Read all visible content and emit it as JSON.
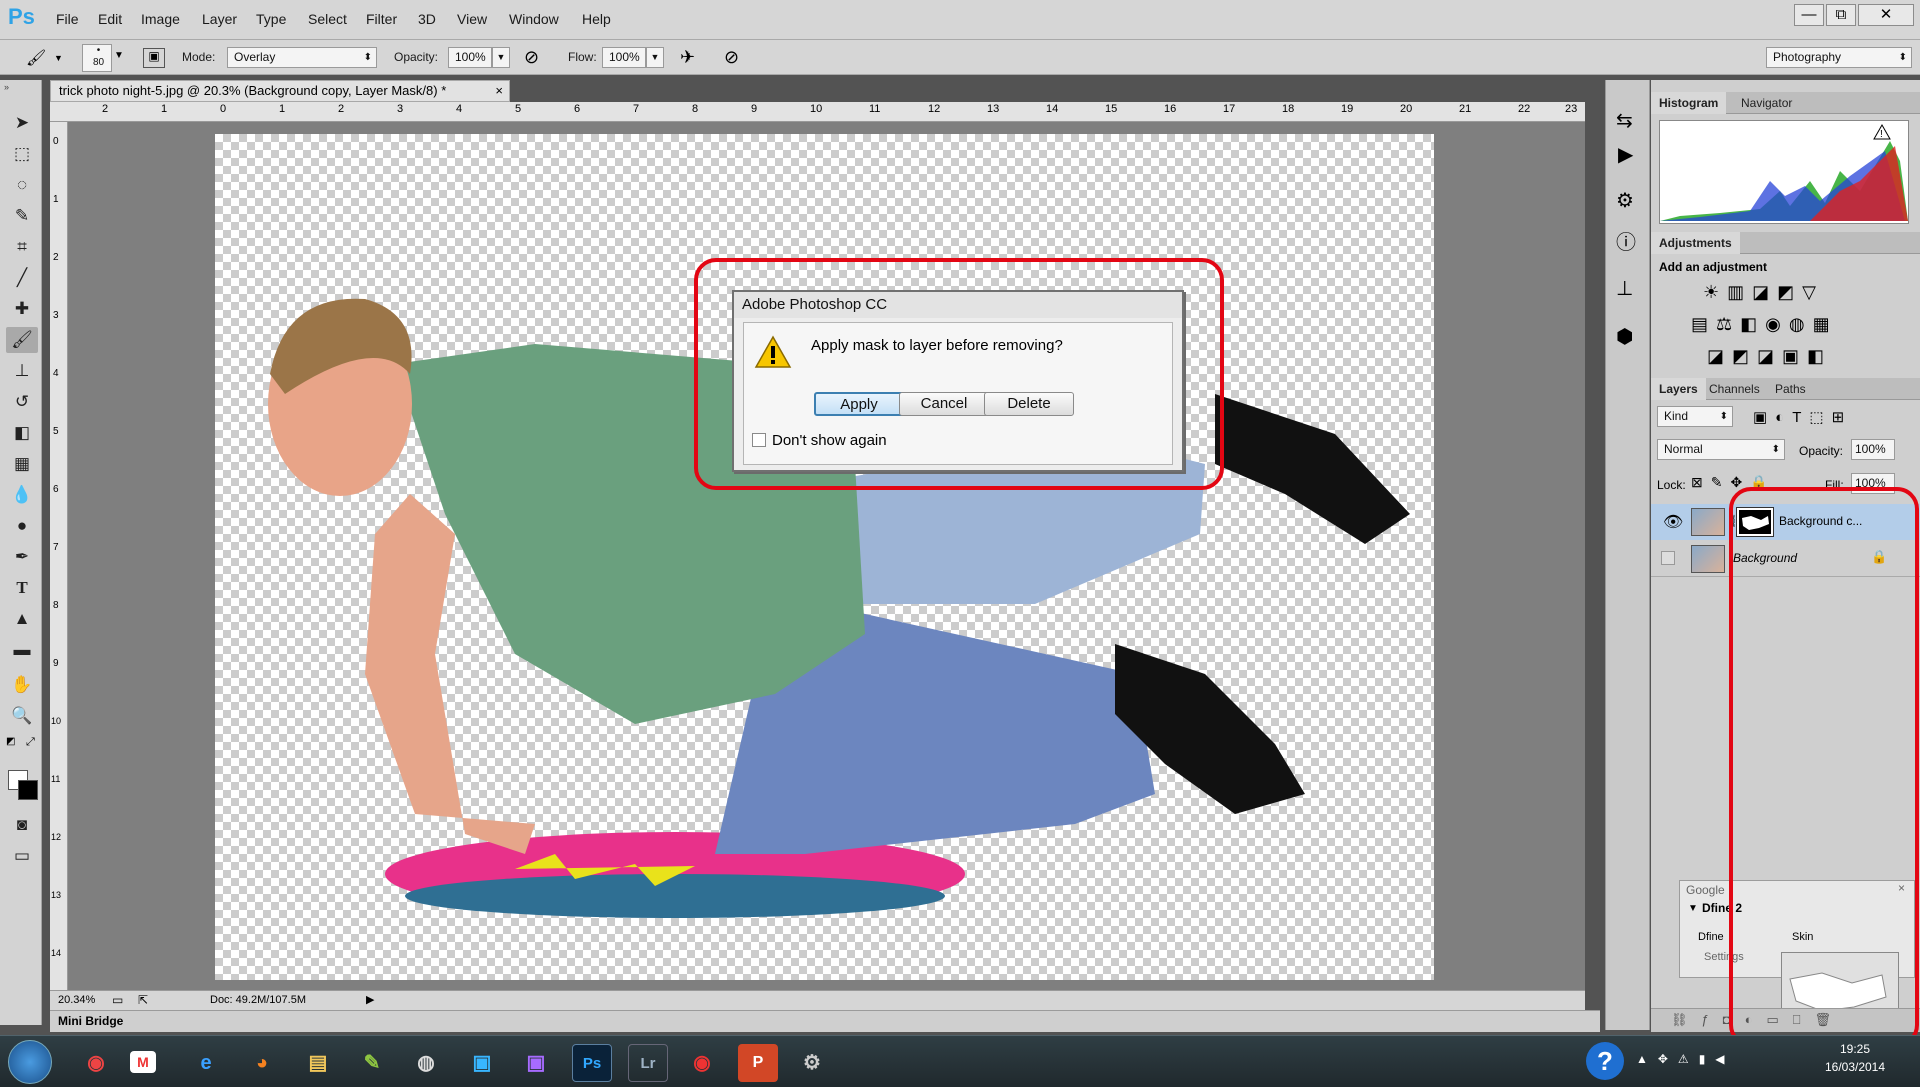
{
  "app": {
    "logo": "Ps"
  },
  "menu": [
    "File",
    "Edit",
    "Image",
    "Layer",
    "Type",
    "Select",
    "Filter",
    "3D",
    "View",
    "Window",
    "Help"
  ],
  "window_controls": {
    "minimize": "—",
    "restore": "⧉",
    "close": "✕"
  },
  "options": {
    "brush_size": "80",
    "mode_label": "Mode:",
    "mode_value": "Overlay",
    "opacity_label": "Opacity:",
    "opacity_value": "100%",
    "flow_label": "Flow:",
    "flow_value": "100%",
    "workspace": "Photography"
  },
  "document": {
    "tab_title": "trick photo night-5.jpg @ 20.3% (Background copy, Layer Mask/8) *",
    "tab_close": "×",
    "ruler_top": [
      "2",
      "1",
      "0",
      "1",
      "2",
      "3",
      "4",
      "5",
      "6",
      "7",
      "8",
      "9",
      "10",
      "11",
      "12",
      "13",
      "14",
      "15",
      "16",
      "17",
      "18",
      "19",
      "20",
      "21",
      "22",
      "23"
    ],
    "ruler_left": [
      "0",
      "1",
      "2",
      "3",
      "4",
      "5",
      "6",
      "7",
      "8",
      "9",
      "10",
      "11",
      "12",
      "13",
      "14"
    ],
    "zoom": "20.34%",
    "doc_info": "Doc: 49.2M/107.5M"
  },
  "mini_bridge": "Mini Bridge",
  "dialog": {
    "title": "Adobe Photoshop CC",
    "message": "Apply mask to layer before removing?",
    "buttons": {
      "apply": "Apply",
      "cancel": "Cancel",
      "delete": "Delete"
    },
    "checkbox_label": "Don't show again",
    "checkbox_checked": false
  },
  "panels": {
    "histogram_tabs": [
      "Histogram",
      "Navigator"
    ],
    "adjustments_tab": "Adjustments",
    "adjustments_heading": "Add an adjustment",
    "layers_tabs": [
      "Layers",
      "Channels",
      "Paths"
    ],
    "kind_filter": "Kind",
    "blend_mode": "Normal",
    "opacity_label": "Opacity:",
    "opacity_value": "100%",
    "lock_label": "Lock:",
    "fill_label": "Fill:",
    "fill_value": "100%",
    "layers": [
      {
        "name": "Background c...",
        "visible": true,
        "selected": true
      },
      {
        "name": "Background",
        "visible": false,
        "selected": false,
        "locked": true
      }
    ]
  },
  "google_widget": {
    "title": "Google",
    "item": "Dfine 2",
    "sub1": "Dfine",
    "sub2": "Skin",
    "settings": "Settings"
  },
  "taskbar": {
    "time": "19:25",
    "date": "16/03/2014",
    "help": "?"
  },
  "colors": {
    "accent": "#2fa3e6",
    "highlight_box": "#e30613",
    "selected_layer": "#b3cde9"
  }
}
